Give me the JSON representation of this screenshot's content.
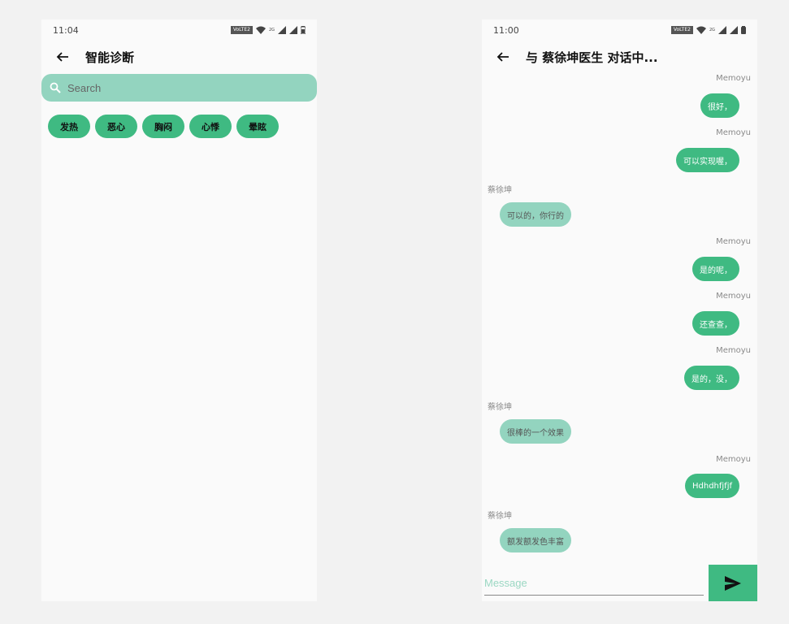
{
  "left_screen": {
    "status_time": "11:04",
    "title": "智能诊断",
    "search": {
      "placeholder": "Search",
      "value": ""
    },
    "symptom_chips": [
      "发热",
      "恶心",
      "胸闷",
      "心悸",
      "晕眩"
    ]
  },
  "right_screen": {
    "status_time": "11:00",
    "title": "与 蔡徐坤医生 对话中...",
    "messages": [
      {
        "sender": "Memoyu",
        "text": "很好，",
        "side": "right"
      },
      {
        "sender": "Memoyu",
        "text": "可以实现喔，",
        "side": "right"
      },
      {
        "sender": "蔡徐坤",
        "text": "可以的，你行的",
        "side": "left"
      },
      {
        "sender": "Memoyu",
        "text": "是的呢，",
        "side": "right"
      },
      {
        "sender": "Memoyu",
        "text": "还查查，",
        "side": "right"
      },
      {
        "sender": "Memoyu",
        "text": "是的，没，",
        "side": "right"
      },
      {
        "sender": "蔡徐坤",
        "text": "很棒的一个效果",
        "side": "left"
      },
      {
        "sender": "Memoyu",
        "text": "Hdhdhfjfjf",
        "side": "right"
      },
      {
        "sender": "蔡徐坤",
        "text": "额发额发色丰富",
        "side": "left"
      }
    ],
    "composer": {
      "placeholder": "Message",
      "value": ""
    }
  },
  "status_icons": [
    "volte-badge",
    "wifi-icon",
    "signal-icon",
    "signal-icon",
    "battery-icon"
  ],
  "volte_label": "VoLTE2",
  "network_label": "2G",
  "colors": {
    "accent": "#3fba82",
    "accent_light": "#93d4bf",
    "background": "#fafafa"
  }
}
